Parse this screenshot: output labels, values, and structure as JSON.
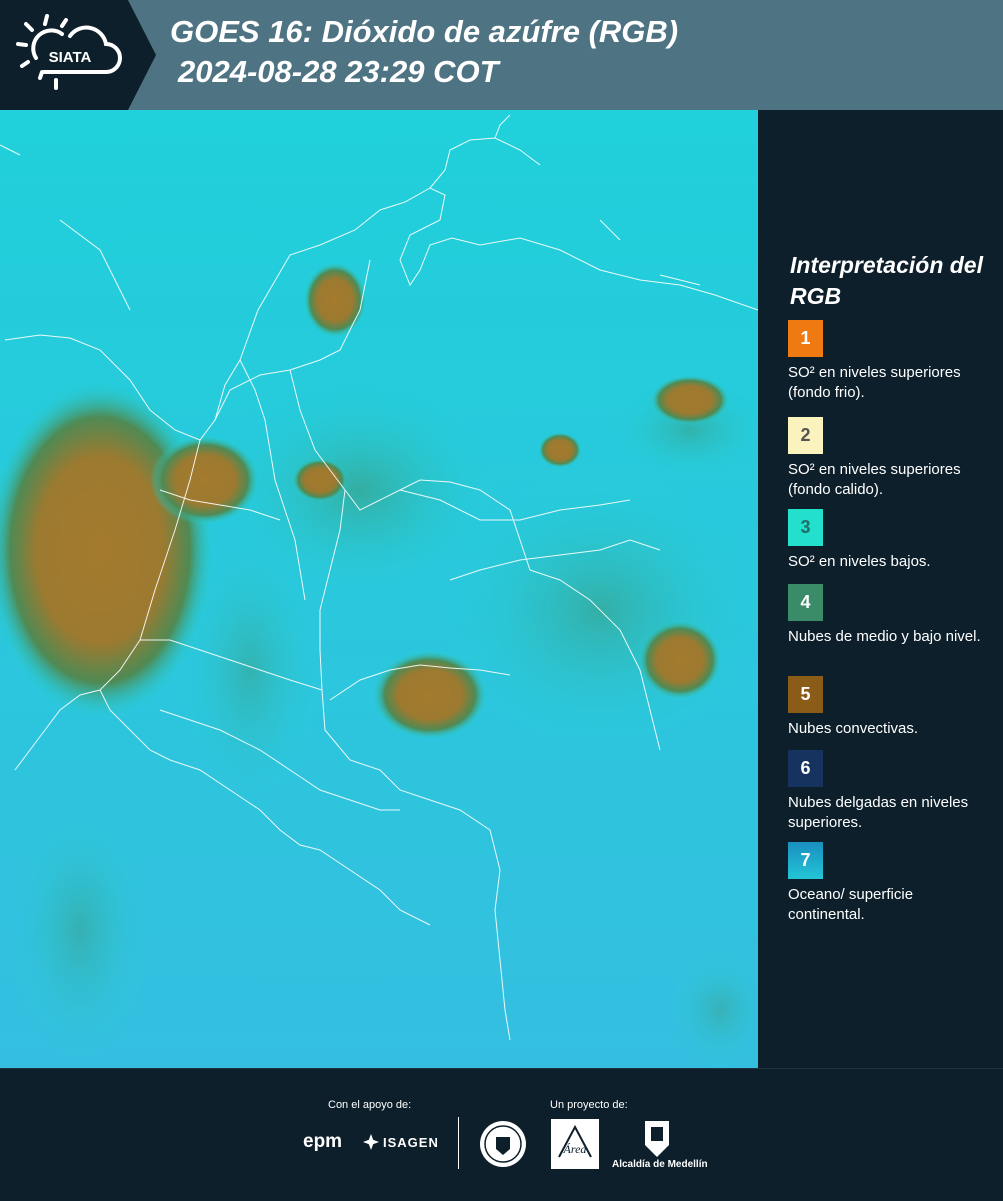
{
  "header": {
    "logo_text": "SIATA",
    "title_line1": "GOES 16: Dióxido de azúfre (RGB)",
    "title_line2": "2024-08-28 23:29 COT"
  },
  "map": {
    "description_icon": "satellite-map",
    "land_color": "#22d6d9",
    "cloud_color": "#a47a2e",
    "low_cloud_color": "#3c9a78",
    "border_color": "#ffffff"
  },
  "legend": {
    "title": "Interpretación del RGB",
    "items": [
      {
        "num": "1",
        "color": "#f07a12",
        "text": "SO² en niveles superiores (fondo frio)."
      },
      {
        "num": "2",
        "color": "#fbf3bd",
        "text": "SO² en niveles superiores (fondo calido)."
      },
      {
        "num": "3",
        "color": "#22e0cc",
        "text": "SO² en niveles bajos."
      },
      {
        "num": "4",
        "color": "#3a8b68",
        "text": "Nubes de medio y bajo nivel."
      },
      {
        "num": "5",
        "color": "#8a5c17",
        "text": "Nubes convectivas."
      },
      {
        "num": "6",
        "color": "#16335f",
        "text": "Nubes delgadas en niveles superiores."
      },
      {
        "num": "7",
        "color": "#1a8fbf",
        "text": "Oceano/ superficie continental."
      }
    ]
  },
  "footer": {
    "support_label": "Con el apoyo de:",
    "project_label": "Un proyecto de:",
    "epm": "epm",
    "isagen": "ISAGEN",
    "area_label": "Área",
    "alcaldia_label": "Alcaldía de Medellín"
  }
}
